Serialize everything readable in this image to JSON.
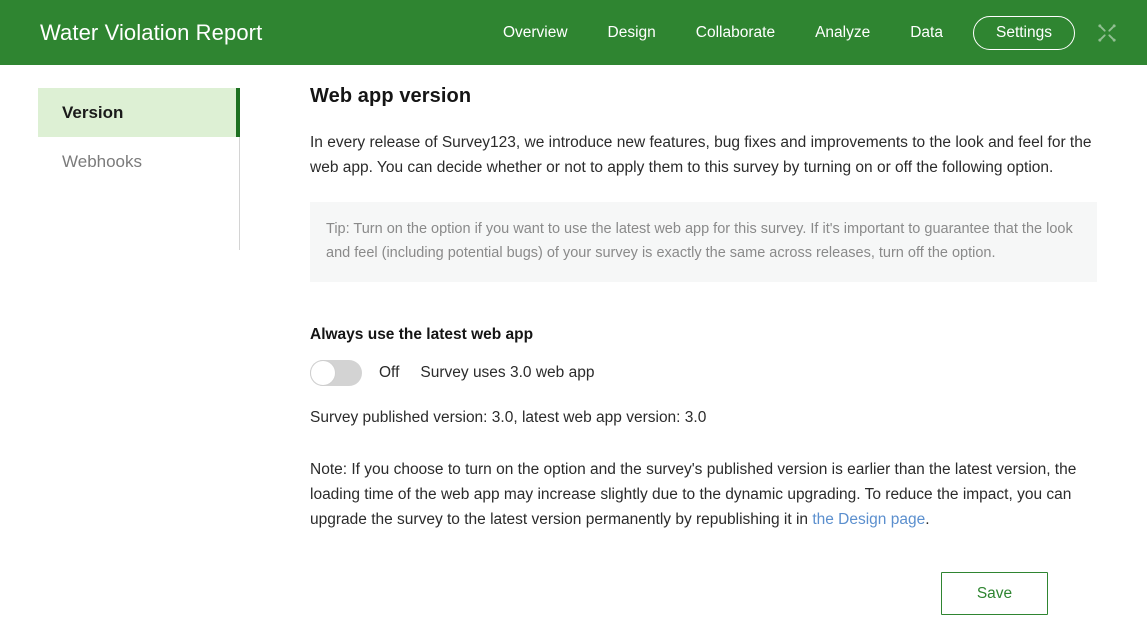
{
  "header": {
    "title": "Water Violation Report",
    "nav_items": [
      {
        "label": "Overview",
        "active": false
      },
      {
        "label": "Design",
        "active": false
      },
      {
        "label": "Collaborate",
        "active": false
      },
      {
        "label": "Analyze",
        "active": false
      },
      {
        "label": "Data",
        "active": false
      }
    ],
    "settings_label": "Settings",
    "icon": "broken-link-icon",
    "background_color": "#2f8531"
  },
  "sidebar": {
    "items": [
      {
        "label": "Version",
        "active": true
      },
      {
        "label": "Webhooks",
        "active": false
      }
    ],
    "active_background_color": "#ddf0d4",
    "active_accent_color": "#1d7021"
  },
  "main": {
    "title": "Web app version",
    "intro": "In every release of Survey123, we introduce new features, bug fixes and improvements to the look and feel for the web app. You can decide whether or not to apply them to this survey by turning on or off the following option.",
    "tip": "Tip: Turn on the option if you want to use the latest web app for this survey. If it's important to guarantee that the look and feel (including potential bugs) of your survey is exactly the same across releases, turn off the option.",
    "option_label": "Always use the latest web app",
    "toggle": {
      "state_label": "Off",
      "is_on": false,
      "description": "Survey uses 3.0 web app"
    },
    "version_line": "Survey published version: 3.0, latest web app version: 3.0",
    "note": {
      "before_link": "Note: If you choose to turn on the option and the survey's published version is earlier than the latest version, the loading time of the web app may increase slightly due to the dynamic upgrading. To reduce the impact, you can upgrade the survey to the latest version permanently by republishing it in ",
      "link_text": "the Design page",
      "after_link": ".",
      "link_color": "#5b8fce"
    },
    "save_label": "Save"
  }
}
